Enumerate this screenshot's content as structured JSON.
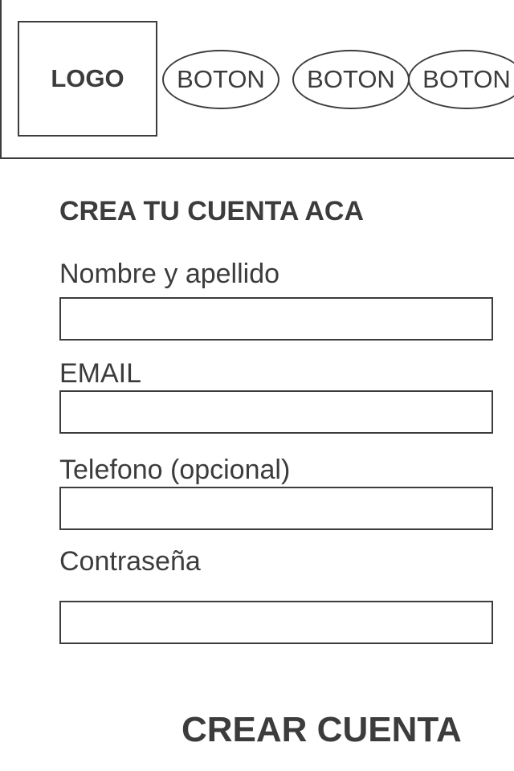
{
  "header": {
    "logo_label": "LOGO",
    "nav_buttons": [
      {
        "label": "BOTON"
      },
      {
        "label": "BOTON"
      },
      {
        "label": "BOTON"
      }
    ]
  },
  "form": {
    "title": "CREA TU CUENTA ACA",
    "fields": [
      {
        "label": "Nombre y apellido",
        "value": "",
        "placeholder": ""
      },
      {
        "label": "EMAIL",
        "value": "",
        "placeholder": ""
      },
      {
        "label": "Telefono (opcional)",
        "value": "",
        "placeholder": ""
      },
      {
        "label": "Contraseña",
        "value": "",
        "placeholder": ""
      }
    ],
    "submit_label": "CREAR CUENTA"
  }
}
